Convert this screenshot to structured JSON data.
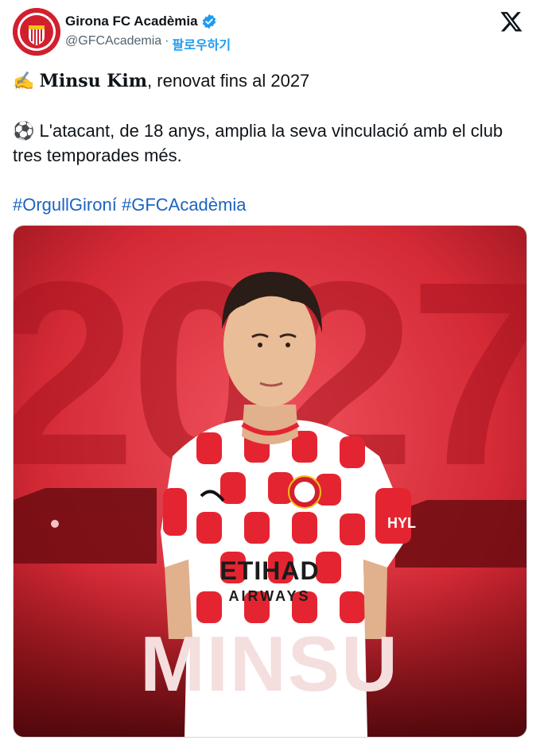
{
  "account": {
    "name": "Girona FC Acadèmia",
    "handle": "@GFCAcademia",
    "separator": "·",
    "follow_label": "팔로우하기",
    "avatar_text": "GIRONA",
    "avatar_subtext": "FUTBOL CLUB"
  },
  "tweet": {
    "line1_emoji": "✍️",
    "line1_name": "Minsu Kim",
    "line1_rest": ", renovat fins al 2027",
    "line2_emoji": "⚽",
    "line2_text": " L'atacant, de 18 anys, amplia la seva vinculació amb el club tres temporades més.",
    "hashtag1": "#OrgullGironí",
    "hashtag2": "#GFCAcadèmia"
  },
  "media": {
    "year": "2027",
    "player_name": "MINSU",
    "sponsor_line1": "ETIHAD",
    "sponsor_line2": "AIRWAYS",
    "sleeve_sponsor": "HYL",
    "colors": {
      "bg_red": "#c8202c",
      "accent_dark": "#8e1118",
      "shirt_red": "#e42531",
      "white": "#ffffff"
    }
  }
}
